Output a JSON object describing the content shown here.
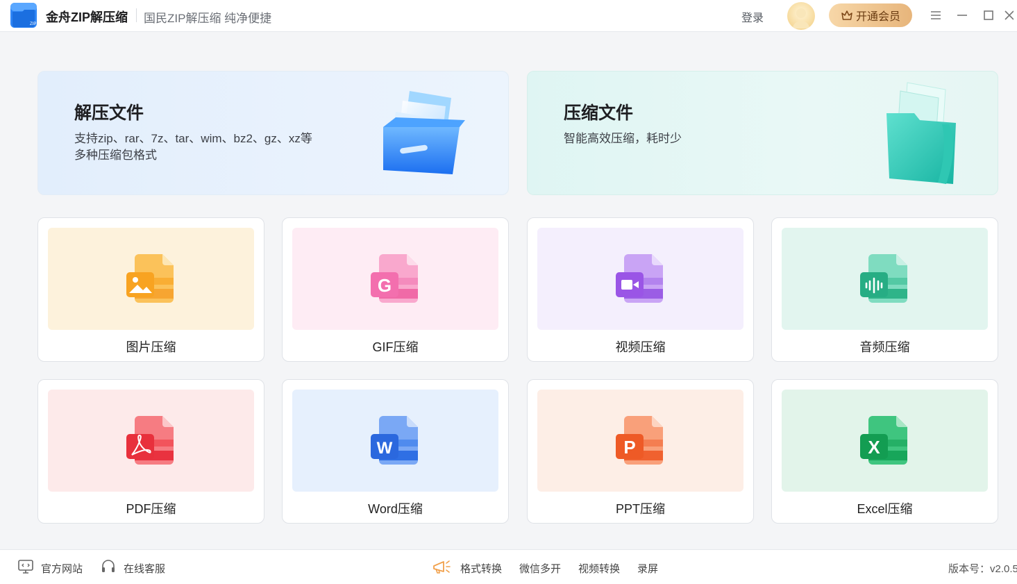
{
  "titlebar": {
    "app_name": "金舟ZIP解压缩",
    "slogan": "国民ZIP解压缩 纯净便捷",
    "login_label": "登录",
    "vip_label": "开通会员",
    "logo_text": "ZIP"
  },
  "banners": {
    "extract": {
      "title": "解压文件",
      "desc_line1": "支持zip、rar、7z、tar、wim、bz2、gz、xz等",
      "desc_line2": "多种压缩包格式"
    },
    "compress": {
      "title": "压缩文件",
      "desc_line1": "智能高效压缩，耗时少"
    }
  },
  "tiles": [
    {
      "label": "图片压缩",
      "icon": "image-file-icon",
      "bg": "#fdf2dc",
      "color": "#f7a531"
    },
    {
      "label": "GIF压缩",
      "icon": "gif-file-icon",
      "bg": "#feecf4",
      "color": "#f06aa7"
    },
    {
      "label": "视频压缩",
      "icon": "video-file-icon",
      "bg": "#f4effd",
      "color": "#9b5de5"
    },
    {
      "label": "音频压缩",
      "icon": "audio-file-icon",
      "bg": "#e2f5ef",
      "color": "#2fb489"
    },
    {
      "label": "PDF压缩",
      "icon": "pdf-file-icon",
      "bg": "#fdeaea",
      "color": "#e9323f"
    },
    {
      "label": "Word压缩",
      "icon": "word-file-icon",
      "bg": "#e6f0fd",
      "color": "#2f6fe4"
    },
    {
      "label": "PPT压缩",
      "icon": "ppt-file-icon",
      "bg": "#fdeee6",
      "color": "#f0612f"
    },
    {
      "label": "Excel压缩",
      "icon": "excel-file-icon",
      "bg": "#e2f4ea",
      "color": "#17a65a"
    }
  ],
  "tile_glyphs": [
    "",
    "G",
    "",
    "",
    "",
    "W",
    "P",
    "X"
  ],
  "bottombar": {
    "website_label": "官方网站",
    "support_label": "在线客服",
    "links": [
      "格式转换",
      "微信多开",
      "视频转换",
      "录屏"
    ],
    "version": "版本号：v2.0.5"
  }
}
